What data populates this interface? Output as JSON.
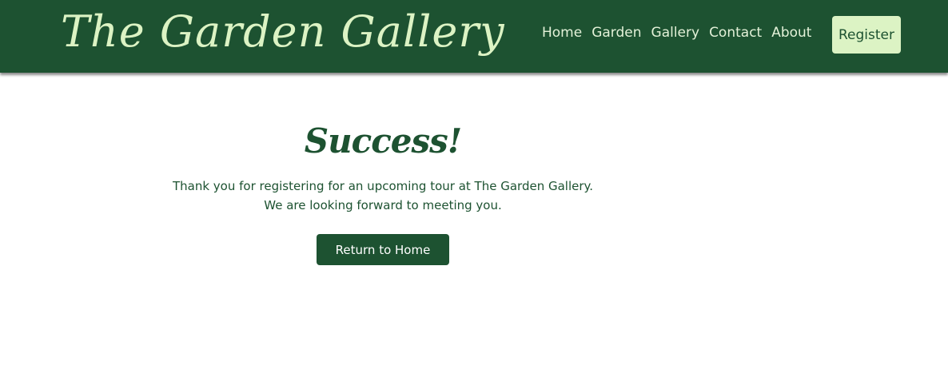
{
  "header": {
    "brand": "The Garden Gallery",
    "nav": [
      {
        "label": "Home"
      },
      {
        "label": "Garden"
      },
      {
        "label": "Gallery"
      },
      {
        "label": "Contact"
      },
      {
        "label": "About"
      }
    ],
    "register_label": "Register"
  },
  "main": {
    "title": "Success!",
    "message_line1": "Thank you for registering for an upcoming tour at The Garden Gallery.",
    "message_line2": "We are looking forward to meeting you.",
    "return_label": "Return to Home"
  },
  "colors": {
    "primary": "#1d5231",
    "accent": "#dcf3c4",
    "background": "#ffffff"
  }
}
